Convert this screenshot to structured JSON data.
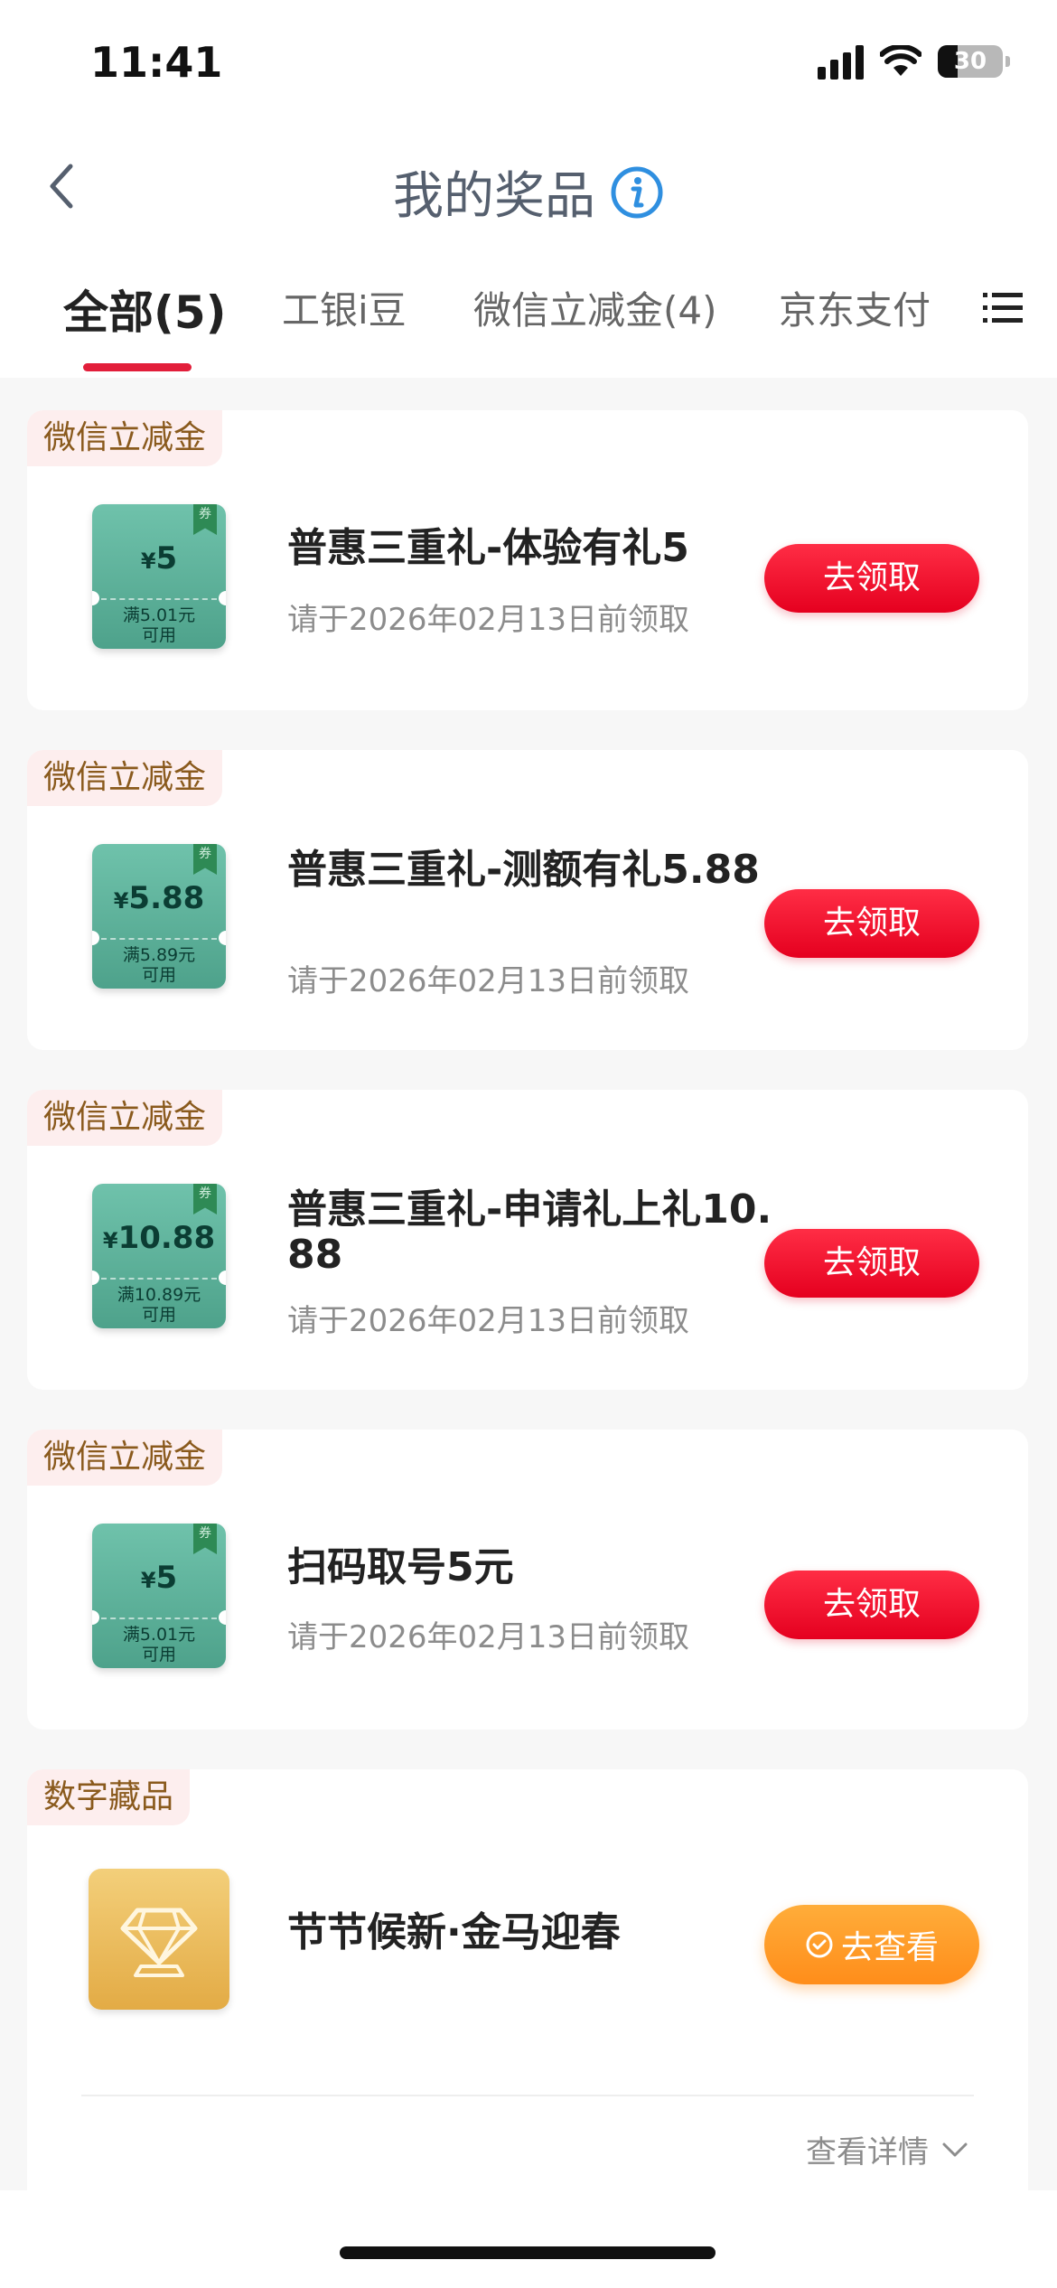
{
  "status_bar": {
    "time": "11:41",
    "battery": "30"
  },
  "header": {
    "title": "我的奖品"
  },
  "tabs": [
    {
      "label": "全部(5)",
      "active": true
    },
    {
      "label": "工银i豆",
      "active": false
    },
    {
      "label": "微信立减金(4)",
      "active": false
    },
    {
      "label": "京东支付",
      "active": false
    }
  ],
  "prizes": [
    {
      "tag": "微信立减金",
      "coupon_symbol": "¥",
      "coupon_amount": "5",
      "coupon_condition_1": "满5.01元",
      "coupon_condition_2": "可用",
      "coupon_badge": "券",
      "title": "普惠三重礼-体验有礼5",
      "subtitle": "请于2026年02月13日前领取",
      "action": "去领取"
    },
    {
      "tag": "微信立减金",
      "coupon_symbol": "¥",
      "coupon_amount": "5.88",
      "coupon_condition_1": "满5.89元",
      "coupon_condition_2": "可用",
      "coupon_badge": "券",
      "title": "普惠三重礼-测额有礼5.88",
      "subtitle": "请于2026年02月13日前领取",
      "action": "去领取"
    },
    {
      "tag": "微信立减金",
      "coupon_symbol": "¥",
      "coupon_amount": "10.88",
      "coupon_condition_1": "满10.89元",
      "coupon_condition_2": "可用",
      "coupon_badge": "券",
      "title": "普惠三重礼-申请礼上礼10.88",
      "subtitle": "请于2026年02月13日前领取",
      "action": "去领取"
    },
    {
      "tag": "微信立减金",
      "coupon_symbol": "¥",
      "coupon_amount": "5",
      "coupon_condition_1": "满5.01元",
      "coupon_condition_2": "可用",
      "coupon_badge": "券",
      "title": "扫码取号5元",
      "subtitle": "请于2026年02月13日前领取",
      "action": "去领取"
    }
  ],
  "collectible": {
    "tag": "数字藏品",
    "title": "节节候新·金马迎春",
    "action": "去查看",
    "details": "查看详情"
  },
  "colors": {
    "accent_red": "#e5001f",
    "accent_orange": "#ff8d1a",
    "coupon_green": "#4ea28b",
    "tag_text": "#8a5a1d"
  }
}
